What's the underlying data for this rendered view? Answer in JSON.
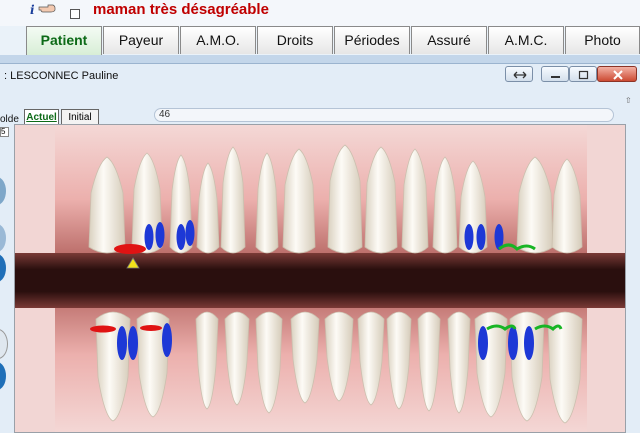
{
  "topbar": {
    "info_icon": "i",
    "hand_icon": "pointing-hand-icon",
    "alert_text": "maman très désagréable"
  },
  "tabs": [
    {
      "label": "Patient",
      "active": true
    },
    {
      "label": "Payeur",
      "active": false
    },
    {
      "label": "A.M.O.",
      "active": false
    },
    {
      "label": "Droits",
      "active": false
    },
    {
      "label": "Périodes",
      "active": false
    },
    {
      "label": "Assuré",
      "active": false
    },
    {
      "label": "A.M.C.",
      "active": false
    },
    {
      "label": "Photo",
      "active": false
    }
  ],
  "window": {
    "title": ": LESCONNEC Pauline",
    "buttons": [
      "restore-arrows-icon",
      "minimize-icon",
      "maximize-icon",
      "close-icon"
    ]
  },
  "panel": {
    "solde_label": "olde",
    "left_value": "5",
    "inner_tabs": [
      {
        "label": "Actuel",
        "active": true
      },
      {
        "label": "Initial",
        "active": false
      }
    ],
    "number_field_value": "46"
  },
  "chart": {
    "colors": {
      "gum": "#efb7b4",
      "mouth": "#2a0f0e",
      "tooth": "#f7f1e6",
      "blue_mark": "#1d38d6",
      "red_mark": "#e01313",
      "green_mark": "#18b524",
      "pointer": "#f2e21a"
    }
  }
}
